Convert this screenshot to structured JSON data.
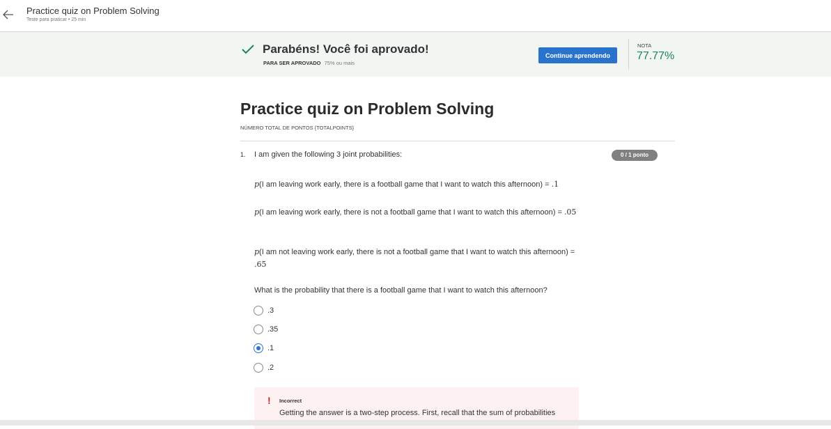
{
  "header": {
    "title": "Practice quiz on Problem Solving",
    "subtitle": "Teste para praticar • 25 min",
    "back_icon": "arrow-left-icon"
  },
  "banner": {
    "message": "Parabéns! Você foi aprovado!",
    "pass_label": "PARA SER APROVADO",
    "pass_value": "75% ou mais",
    "continue_button": "Continue aprendendo",
    "grade_label": "NOTA",
    "grade_value": "77.77%",
    "icon": "check-icon",
    "accent_color": "#1f8354"
  },
  "quiz": {
    "title": "Practice quiz on Problem Solving",
    "total_points": "NÚMERO TOTAL DE PONTOS {TOTALPOINTS}"
  },
  "question": {
    "number": "1.",
    "text": "I am given the following 3 joint probabilities:",
    "points": "0 / 1 ponto",
    "probabilities": [
      {
        "p": "p",
        "text": "(I am leaving work early, there is a football game that I want to watch this afternoon) = ",
        "value": ".1"
      },
      {
        "p": "p",
        "text": "(I am leaving work early, there is not a football game that I want to watch this afternoon) = ",
        "value": ".05"
      },
      {
        "p": "p",
        "text": "(I am not leaving work early, there is not a football game that I want to watch this afternoon) = ",
        "value": ".65"
      }
    ],
    "prompt": "What is the probability that there is a football game that I want to watch this afternoon?",
    "options": [
      {
        "label": ".3",
        "selected": false
      },
      {
        "label": ".35",
        "selected": false
      },
      {
        "label": ".1",
        "selected": true
      },
      {
        "label": ".2",
        "selected": false
      }
    ],
    "feedback": {
      "icon": "exclamation-icon",
      "title": "Incorrect",
      "text": "Getting the answer is a two-step process. First, recall that the sum of probabilities"
    }
  }
}
